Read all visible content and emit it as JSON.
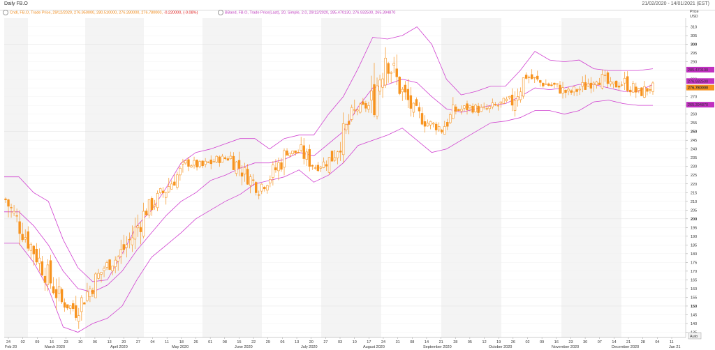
{
  "window": {
    "title": "Daily FB.O",
    "range": "21/02/2020 - 14/01/2021 (EST)"
  },
  "legend": {
    "close_label": "Cndl, FB.O, Trade Price, 29/12/2020, 276.950000, 280.510000, 276.280000, 276.780000,",
    "close_change": "-0.220000, (-0.08%)",
    "bb_label": "BBand, FB.O, Trade Price(Last), 20, Simple, 2.0, 29/12/2020, 285.470130, 276.932500, 265.394870"
  },
  "axis": {
    "price_label": "Price",
    "currency_label": "USD",
    "auto_label": "Auto"
  },
  "colors": {
    "candle": "#f7931e",
    "band": "#d040d0",
    "last_price_bg": "#f7931e",
    "band_tag_bg": "#c030c0"
  },
  "chart_data": {
    "type": "candlestick",
    "ylim": [
      132,
      315
    ],
    "yticks": [
      135,
      140,
      145,
      150,
      155,
      160,
      165,
      170,
      175,
      180,
      185,
      190,
      195,
      200,
      205,
      210,
      215,
      220,
      225,
      230,
      235,
      240,
      245,
      250,
      255,
      260,
      265,
      270,
      275,
      280,
      285,
      290,
      295,
      300,
      305,
      310
    ],
    "major_ticks": [
      150,
      200,
      250,
      300
    ],
    "price_tags": [
      {
        "value": 285.47013,
        "label": "285.470130",
        "kind": "band"
      },
      {
        "value": 276.9325,
        "label": "276.932500",
        "kind": "band"
      },
      {
        "value": 276.78,
        "label": "276.780000",
        "kind": "last"
      },
      {
        "value": 265.39487,
        "label": "265.394870",
        "kind": "band"
      }
    ],
    "day_labels": [
      "24",
      "02",
      "09",
      "16",
      "23",
      "30",
      "06",
      "13",
      "20",
      "27",
      "04",
      "11",
      "18",
      "26",
      "01",
      "08",
      "15",
      "22",
      "29",
      "06",
      "13",
      "20",
      "27",
      "03",
      "10",
      "17",
      "24",
      "31",
      "08",
      "14",
      "21",
      "28",
      "05",
      "12",
      "19",
      "26",
      "02",
      "09",
      "16",
      "23",
      "30",
      "07",
      "14",
      "21",
      "28",
      "04",
      "11"
    ],
    "month_labels": [
      "Feb 20",
      "March 2020",
      "April 2020",
      "May 2020",
      "June 2020",
      "July 2020",
      "August 2020",
      "September 2020",
      "October 2020",
      "November 2020",
      "December 2020",
      "Jan 21"
    ],
    "weekly_close": [
      211,
      196,
      182,
      167,
      152,
      148,
      160,
      172,
      178,
      190,
      205,
      213,
      223,
      232,
      230,
      234,
      235,
      226,
      218,
      226,
      238,
      238,
      230,
      233,
      248,
      263,
      265,
      295,
      275,
      262,
      255,
      252,
      262,
      264,
      262,
      265,
      268,
      282,
      278,
      276,
      272,
      275,
      282,
      276,
      278,
      272,
      276
    ],
    "upper_band": [
      224,
      224,
      215,
      210,
      188,
      172,
      164,
      165,
      180,
      196,
      205,
      218,
      232,
      238,
      240,
      243,
      246,
      246,
      240,
      246,
      248,
      248,
      260,
      270,
      286,
      304,
      303,
      305,
      310,
      300,
      280,
      271,
      273,
      276,
      276,
      285,
      296,
      291,
      290,
      291,
      286,
      285,
      285,
      285,
      286
    ],
    "mid_band": [
      204,
      204,
      196,
      185,
      170,
      160,
      158,
      162,
      170,
      182,
      192,
      202,
      210,
      215,
      222,
      225,
      229,
      232,
      232,
      234,
      238,
      236,
      243,
      250,
      264,
      275,
      277,
      280,
      278,
      270,
      263,
      261,
      263,
      265,
      266,
      270,
      275,
      274,
      275,
      277,
      277,
      275,
      273,
      273,
      277
    ],
    "lower_band": [
      186,
      186,
      175,
      160,
      138,
      135,
      140,
      143,
      150,
      165,
      178,
      185,
      192,
      200,
      205,
      210,
      214,
      220,
      222,
      224,
      228,
      221,
      225,
      232,
      242,
      245,
      248,
      252,
      245,
      238,
      240,
      245,
      250,
      255,
      256,
      258,
      262,
      262,
      260,
      262,
      267,
      268,
      266,
      265,
      265
    ]
  }
}
